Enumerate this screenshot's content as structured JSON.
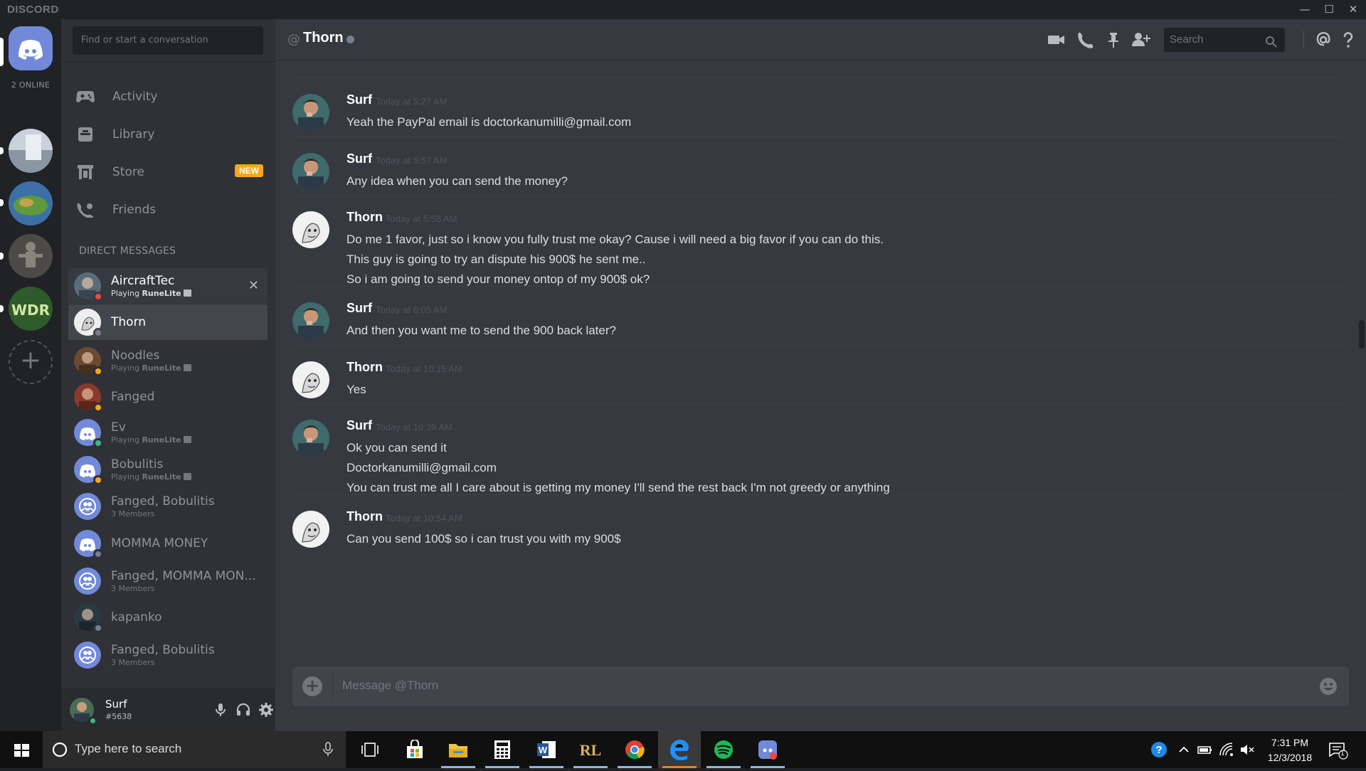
{
  "window": {
    "brand": "DISCORD",
    "controls": {
      "minimize": "—",
      "maximize": "☐",
      "close": "✕"
    }
  },
  "guilds": {
    "online_count": "2 ONLINE",
    "items": [
      {
        "name": "home",
        "color": "#7289da"
      },
      {
        "name": "server-1",
        "color": "#a6b1bf"
      },
      {
        "name": "server-2",
        "color": "#4a7bb2"
      },
      {
        "name": "server-3",
        "color": "#5c5c57"
      },
      {
        "name": "server-wdr",
        "color": "#3f6e3c"
      }
    ],
    "add_label": "+"
  },
  "sidebar": {
    "search_placeholder": "Find or start a conversation",
    "nav": [
      {
        "label": "Activity",
        "icon": "gamepad-icon"
      },
      {
        "label": "Library",
        "icon": "library-icon"
      },
      {
        "label": "Store",
        "icon": "store-icon",
        "badge": "NEW"
      },
      {
        "label": "Friends",
        "icon": "friends-icon"
      }
    ],
    "dm_header": "DIRECT MESSAGES",
    "dms": [
      {
        "name": "AircraftTec",
        "activity_prefix": "Playing ",
        "activity": "RuneLite",
        "status": "dnd",
        "avatar_color": "#5b6b7a"
      },
      {
        "name": "Thorn",
        "activity_prefix": "",
        "activity": "",
        "status": "offline",
        "avatar_color": "#e6e6e6"
      },
      {
        "name": "Noodles",
        "activity_prefix": "Playing ",
        "activity": "RuneLite",
        "status": "idle",
        "avatar_color": "#6b4a32"
      },
      {
        "name": "Fanged",
        "activity_prefix": "",
        "activity": "",
        "status": "idle",
        "avatar_color": "#8a3a2a"
      },
      {
        "name": "Ev",
        "activity_prefix": "Playing ",
        "activity": "RuneLite",
        "status": "online",
        "avatar_color": "#7289da"
      },
      {
        "name": "Bobulitis",
        "activity_prefix": "Playing ",
        "activity": "RuneLite",
        "status": "idle",
        "avatar_color": "#7289da"
      },
      {
        "name": "Fanged, Bobulitis",
        "activity_prefix": "",
        "activity": "3 Members",
        "status": "",
        "avatar_color": "#7289da"
      },
      {
        "name": "MOMMA MONEY",
        "activity_prefix": "",
        "activity": "",
        "status": "offline",
        "avatar_color": "#7289da"
      },
      {
        "name": "Fanged, MOMMA MON...",
        "activity_prefix": "",
        "activity": "3 Members",
        "status": "",
        "avatar_color": "#7289da"
      },
      {
        "name": "kapanko",
        "activity_prefix": "",
        "activity": "",
        "status": "offline",
        "avatar_color": "#2a3a44"
      },
      {
        "name": "Fanged, Bobulitis",
        "activity_prefix": "",
        "activity": "3 Members",
        "status": "",
        "avatar_color": "#7289da"
      }
    ]
  },
  "user": {
    "name": "Surf",
    "tag": "#5638"
  },
  "chat": {
    "at": "@",
    "title": "Thorn",
    "search_placeholder": "Search",
    "composer_placeholder": "Message @Thorn",
    "messages": [
      {
        "author": "Surf",
        "time": "Today at 5:27 AM",
        "avatar": "surf",
        "lines": [
          "Yeah the PayPal email is doctorkanumilli@gmail.com"
        ]
      },
      {
        "author": "Surf",
        "time": "Today at 5:57 AM",
        "avatar": "surf",
        "lines": [
          "Any idea when you can send the money?"
        ]
      },
      {
        "author": "Thorn",
        "time": "Today at 5:58 AM",
        "avatar": "thorn",
        "lines": [
          "Do me 1 favor, just so i know you fully trust me okay? Cause i will need a big favor if you can do this.",
          "This guy is going to try an dispute his 900$ he sent me..",
          "So i am going to send your money ontop of my 900$ ok?"
        ]
      },
      {
        "author": "Surf",
        "time": "Today at 6:05 AM",
        "avatar": "surf",
        "lines": [
          "And then you want me to send the 900 back later?"
        ]
      },
      {
        "author": "Thorn",
        "time": "Today at 10:15 AM",
        "avatar": "thorn",
        "lines": [
          "Yes"
        ]
      },
      {
        "author": "Surf",
        "time": "Today at 10:39 AM",
        "avatar": "surf",
        "lines": [
          "Ok you can send it",
          "Doctorkanumilli@gmail.com",
          "You can trust me all I care about is getting my money I'll send the rest back I'm not greedy or anything"
        ]
      },
      {
        "author": "Thorn",
        "time": "Today at 10:54 AM",
        "avatar": "thorn",
        "lines": [
          "Can you send 100$ so i can trust you with my 900$"
        ]
      }
    ]
  },
  "taskbar": {
    "search_placeholder": "Type here to search",
    "apps": [
      "task-view",
      "store",
      "file-explorer",
      "calculator",
      "word",
      "runelite",
      "chrome",
      "edge",
      "spotify",
      "discord"
    ],
    "time": "7:31 PM",
    "date": "12/3/2018",
    "notification_count": "1"
  },
  "colors": {
    "accent": "#7289da",
    "online": "#43b581",
    "idle": "#faa61a",
    "dnd": "#f04747",
    "offline": "#747f8d"
  }
}
